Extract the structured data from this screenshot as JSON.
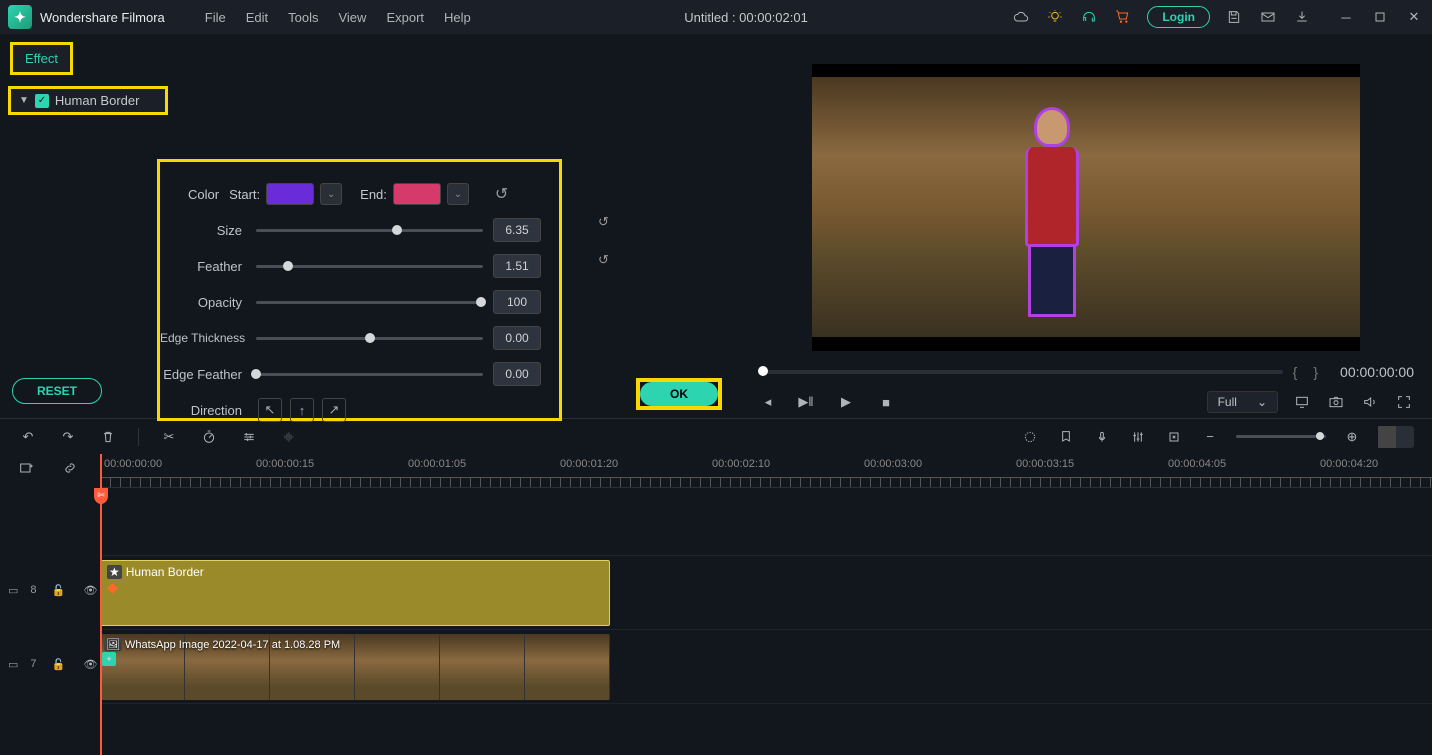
{
  "titlebar": {
    "app_name": "Wondershare Filmora",
    "menu": [
      "File",
      "Edit",
      "Tools",
      "View",
      "Export",
      "Help"
    ],
    "title": "Untitled : 00:00:02:01",
    "login": "Login"
  },
  "effect": {
    "tab": "Effect",
    "section": "Human Border",
    "color_label": "Color",
    "start_label": "Start:",
    "end_label": "End:",
    "color_start": "#6a2bd9",
    "color_end": "#d53a6a",
    "params": [
      {
        "label": "Size",
        "value": "6.35",
        "pos": 62
      },
      {
        "label": "Feather",
        "value": "1.51",
        "pos": 14
      },
      {
        "label": "Opacity",
        "value": "100",
        "pos": 99
      },
      {
        "label": "Edge Thickness",
        "value": "0.00",
        "pos": 50
      },
      {
        "label": "Edge Feather",
        "value": "0.00",
        "pos": 0
      }
    ],
    "direction_label": "Direction",
    "reset": "RESET",
    "ok": "OK"
  },
  "playback": {
    "time_end": "00:00:00:00",
    "quality": "Full"
  },
  "timeline": {
    "ticks": [
      "00:00:00:00",
      "00:00:00:15",
      "00:00:01:05",
      "00:00:01:20",
      "00:00:02:10",
      "00:00:03:00",
      "00:00:03:15",
      "00:00:04:05",
      "00:00:04:20"
    ],
    "tracks": {
      "effect": {
        "num": "8",
        "label": "Human Border"
      },
      "video": {
        "num": "7",
        "label": "WhatsApp Image 2022-04-17 at 1.08.28 PM"
      }
    }
  }
}
